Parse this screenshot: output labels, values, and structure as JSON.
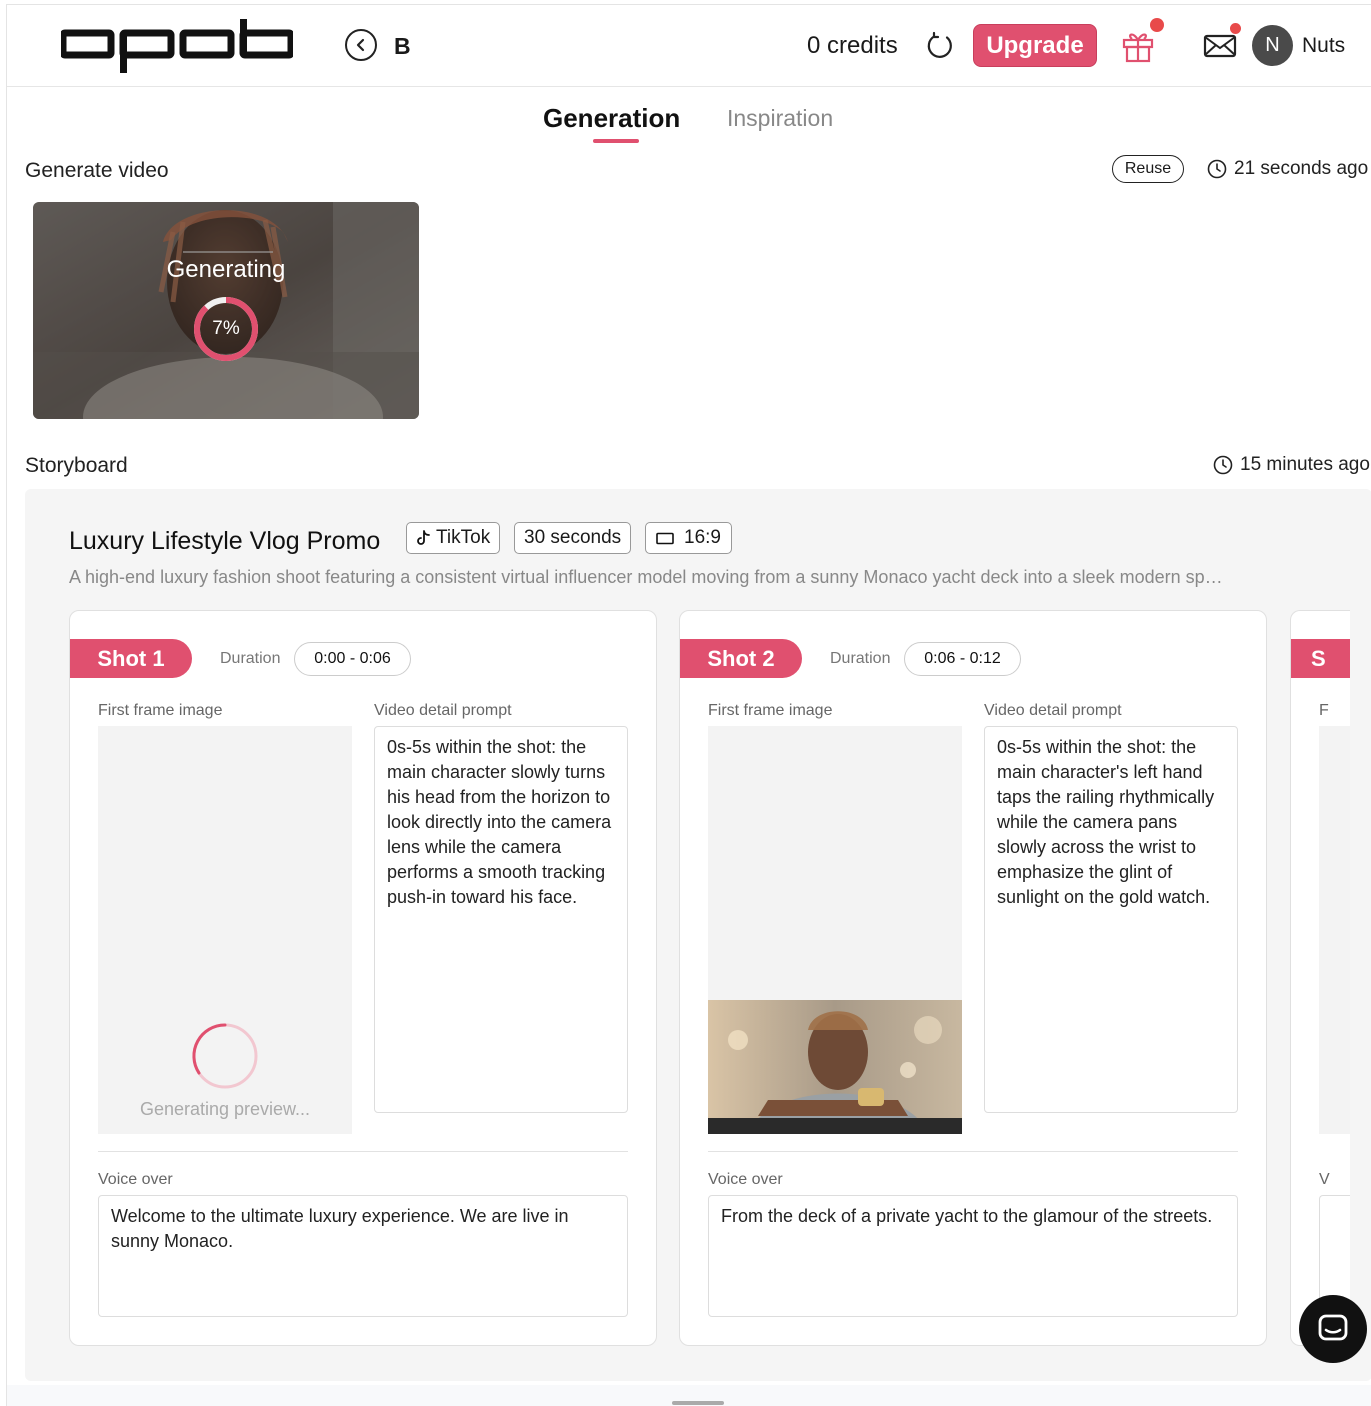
{
  "header": {
    "logo_text": "apob",
    "project_letter": "B",
    "credits": "0 credits",
    "upgrade_label": "Upgrade",
    "user_initial": "N",
    "user_name": "Nuts",
    "accent_color": "#e0506f"
  },
  "tabs": [
    {
      "label": "Generation",
      "active": true
    },
    {
      "label": "Inspiration",
      "active": false
    }
  ],
  "generate": {
    "title": "Generate video",
    "reuse_label": "Reuse",
    "time": "21 seconds ago",
    "status": "Generating",
    "progress": 0.07,
    "progress_label": "7%"
  },
  "storyboard": {
    "title": "Storyboard",
    "time": "15 minutes ago",
    "project_title": "Luxury Lifestyle Vlog Promo",
    "platform": "TikTok",
    "length": "30 seconds",
    "ratio": "16:9",
    "description": "A high-end luxury fashion shoot featuring a consistent virtual influencer model moving from a sunny Monaco yacht deck into a sleek modern sp…",
    "duration_label": "Duration",
    "first_frame_label": "First frame image",
    "prompt_label": "Video detail prompt",
    "voice_label": "Voice over",
    "generating_preview": "Generating preview...",
    "shots": [
      {
        "name": "Shot 1",
        "duration": "0:00 - 0:06",
        "prompt": "0s-5s within the shot: the main character slowly turns his head from the horizon to look directly into the camera lens while the camera performs a smooth tracking push-in toward his face.",
        "voice": "Welcome to the ultimate luxury experience. We are live in sunny Monaco."
      },
      {
        "name": "Shot 2",
        "duration": "0:06 - 0:12",
        "prompt": "0s-5s within the shot: the main character's left hand taps the railing rhythmically while the camera pans slowly across the wrist to emphasize the glint of sunlight on the gold watch.",
        "voice": "From the deck of a private yacht to the glamour of the streets."
      }
    ],
    "partial_shot_initial": "S",
    "partial_first_frame_initial": "F",
    "partial_voice_initial": "V"
  },
  "icons": {
    "back": "chevron-left-circle-icon",
    "refresh": "refresh-icon",
    "gift": "gift-icon",
    "mail": "mail-icon",
    "clock": "clock-icon",
    "tiktok": "tiktok-icon",
    "ratio": "aspect-ratio-icon",
    "chat": "chat-icon"
  }
}
